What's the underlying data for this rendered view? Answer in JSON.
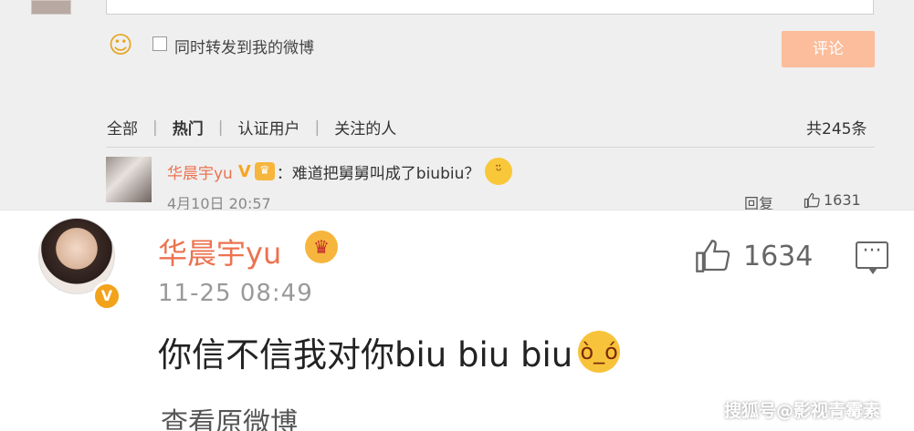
{
  "top": {
    "repost_label": "同时转发到我的微博",
    "comment_button": "评论",
    "tabs": [
      "全部",
      "热门",
      "认证用户",
      "关注的人"
    ],
    "total_count": "共245条",
    "comment": {
      "username": "华晨宇yu",
      "verified_mark": "V",
      "text": "：难道把舅舅叫成了biubiu？",
      "time": "4月10日 20:57",
      "reply_label": "回复",
      "likes": "1631"
    }
  },
  "bottom": {
    "username": "华晨宇yu",
    "verified_mark": "V",
    "time": "11-25 08:49",
    "likes": "1634",
    "text": "你信不信我对你biu biu biu",
    "view_original": "查看原微博",
    "watermark": "搜狐号@影视青霉素"
  },
  "icons": {
    "emoji": "smiley-face-icon",
    "like": "thumbs-up-icon",
    "more": "comment-bubble-icon",
    "crown": "crown-badge-icon"
  },
  "colors": {
    "username": "#eb7350",
    "comment_button_bg": "#fbbd9b",
    "verified_badge": "#f2a21b",
    "top_background": "#efefef"
  }
}
